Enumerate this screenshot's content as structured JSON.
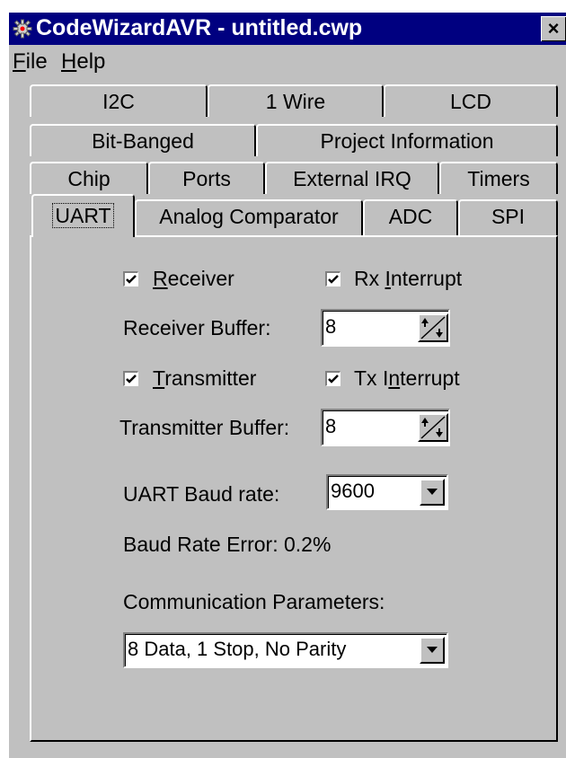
{
  "window": {
    "title": "CodeWizardAVR - untitled.cwp",
    "close_glyph": "×"
  },
  "menu": {
    "file": {
      "accel": "F",
      "rest": "ile"
    },
    "help": {
      "accel": "H",
      "rest": "elp"
    }
  },
  "tabs": {
    "row1": [
      "I2C",
      "1 Wire",
      "LCD"
    ],
    "row2": [
      "Bit-Banged",
      "Project Information"
    ],
    "row3": [
      "Chip",
      "Ports",
      "External IRQ",
      "Timers"
    ],
    "row4": [
      "UART",
      "Analog Comparator",
      "ADC",
      "SPI"
    ],
    "active": "UART"
  },
  "uart": {
    "receiver": {
      "accel": "R",
      "rest": "eceiver",
      "checked": true
    },
    "rx_interrupt": {
      "pre": "Rx ",
      "accel": "I",
      "rest": "nterrupt",
      "checked": true
    },
    "receiver_buffer_label": "Receiver Buffer:",
    "receiver_buffer_value": "8",
    "transmitter": {
      "accel": "T",
      "rest": "ransmitter",
      "checked": true
    },
    "tx_interrupt": {
      "pre": "Tx I",
      "accel": "n",
      "rest": "terrupt",
      "checked": true
    },
    "transmitter_buffer_label": "Transmitter Buffer:",
    "transmitter_buffer_value": "8",
    "baud_label": "UART Baud rate:",
    "baud_value": "9600",
    "baud_error": "Baud Rate Error: 0.2%",
    "comm_label": "Communication Parameters:",
    "comm_value": "8 Data, 1 Stop, No Parity"
  },
  "icons": {
    "app": "gear-icon",
    "checkbox": "check-icon",
    "spin": "spin-arrows-icon",
    "dropdown": "chevron-down-icon"
  }
}
